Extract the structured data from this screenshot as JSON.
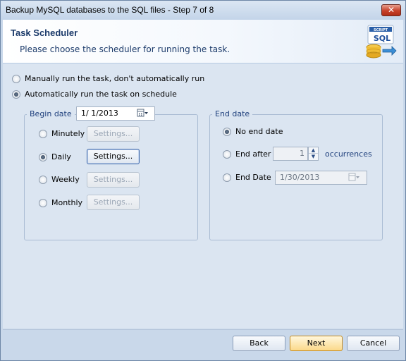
{
  "window": {
    "title": "Backup MySQL databases to the SQL files - Step 7 of 8",
    "close_label": "✕"
  },
  "header": {
    "title": "Task Scheduler",
    "subtitle": "Please choose the scheduler for running the task.",
    "logo_text_top": "SCRIPT",
    "logo_text_main": "SQL"
  },
  "run_mode": {
    "manual_label": "Manually run the task, don't automatically run",
    "auto_label": "Automatically run the task on schedule",
    "selected": "auto"
  },
  "begin_date": {
    "legend": "Begin date",
    "value": "1/  1/2013",
    "frequencies": [
      {
        "label": "Minutely",
        "settings_label": "Settings...",
        "selected": false,
        "settings_enabled": false
      },
      {
        "label": "Daily",
        "settings_label": "Settings...",
        "selected": true,
        "settings_enabled": true
      },
      {
        "label": "Weekly",
        "settings_label": "Settings...",
        "selected": false,
        "settings_enabled": false
      },
      {
        "label": "Monthly",
        "settings_label": "Settings...",
        "selected": false,
        "settings_enabled": false
      }
    ]
  },
  "end_date": {
    "legend": "End date",
    "no_end_label": "No end date",
    "end_after_label": "End after",
    "occurrences_value": "1",
    "occurrences_label": "occurrences",
    "end_date_label": "End Date",
    "end_date_value": "1/30/2013",
    "selected": "no_end"
  },
  "footer": {
    "back_label": "Back",
    "next_label": "Next",
    "cancel_label": "Cancel"
  }
}
